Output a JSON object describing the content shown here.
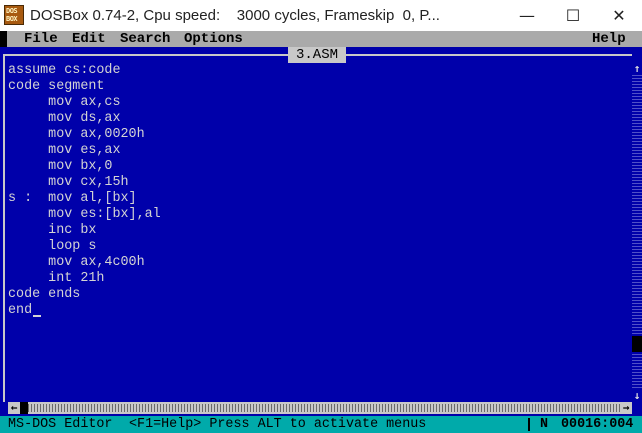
{
  "window": {
    "title": "DOSBox 0.74-2, Cpu speed:    3000 cycles, Frameskip  0, P...",
    "icon_text": [
      "DOS",
      "BOX"
    ],
    "controls": {
      "minimize": "—",
      "maximize": "☐",
      "close": "✕"
    }
  },
  "menubar": {
    "items": [
      "File",
      "Edit",
      "Search",
      "Options"
    ],
    "help": "Help"
  },
  "editor": {
    "filename": "3.ASM",
    "lines": [
      "assume cs:code",
      "code segment",
      "     mov ax,cs",
      "     mov ds,ax",
      "     mov ax,0020h",
      "     mov es,ax",
      "     mov bx,0",
      "     mov cx,15h",
      "s :  mov al,[bx]",
      "     mov es:[bx],al",
      "     inc bx",
      "     loop s",
      "     mov ax,4c00h",
      "     int 21h",
      "code ends",
      "end"
    ],
    "scroll_up": "↑",
    "scroll_down": "↓",
    "scroll_left": "←",
    "scroll_right": "→"
  },
  "statusbar": {
    "app": "MS-DOS Editor",
    "hint": "<F1=Help> Press ALT to activate menus",
    "mode": "N",
    "position": "00016:004"
  },
  "colors": {
    "editor_bg": "#0000aa",
    "editor_text": "#d4d4d4",
    "menubar_bg": "#aaaaaa",
    "statusbar_bg": "#00aaaa"
  }
}
